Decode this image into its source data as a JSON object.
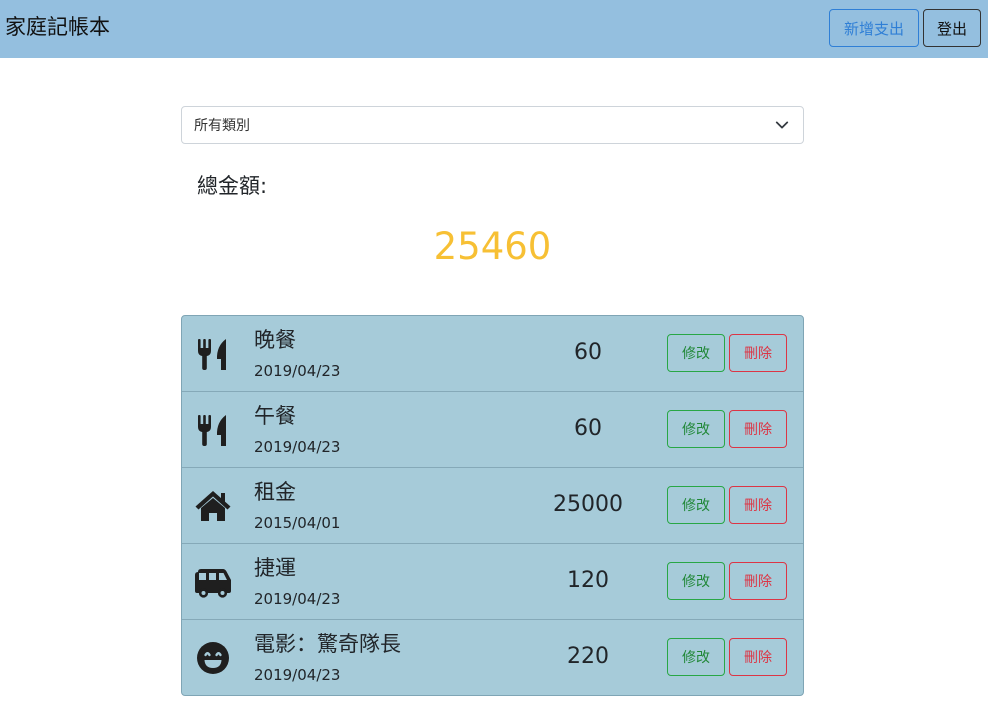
{
  "navbar": {
    "brand": "家庭記帳本",
    "add_expense_label": "新增支出",
    "logout_label": "登出"
  },
  "filter": {
    "selected": "所有類別",
    "icon": "chevron-down-icon"
  },
  "summary": {
    "total_label": "總金額:",
    "total_value": "25460",
    "total_color": "#f7c034"
  },
  "actions": {
    "edit_label": "修改",
    "delete_label": "刪除"
  },
  "expenses": [
    {
      "icon": "utensils-icon",
      "name": "晚餐",
      "date": "2019/04/23",
      "amount": "60"
    },
    {
      "icon": "utensils-icon",
      "name": "午餐",
      "date": "2019/04/23",
      "amount": "60"
    },
    {
      "icon": "home-icon",
      "name": "租金",
      "date": "2015/04/01",
      "amount": "25000"
    },
    {
      "icon": "bus-icon",
      "name": "捷運",
      "date": "2019/04/23",
      "amount": "120"
    },
    {
      "icon": "smile-icon",
      "name": "電影：驚奇隊長",
      "date": "2019/04/23",
      "amount": "220"
    }
  ]
}
